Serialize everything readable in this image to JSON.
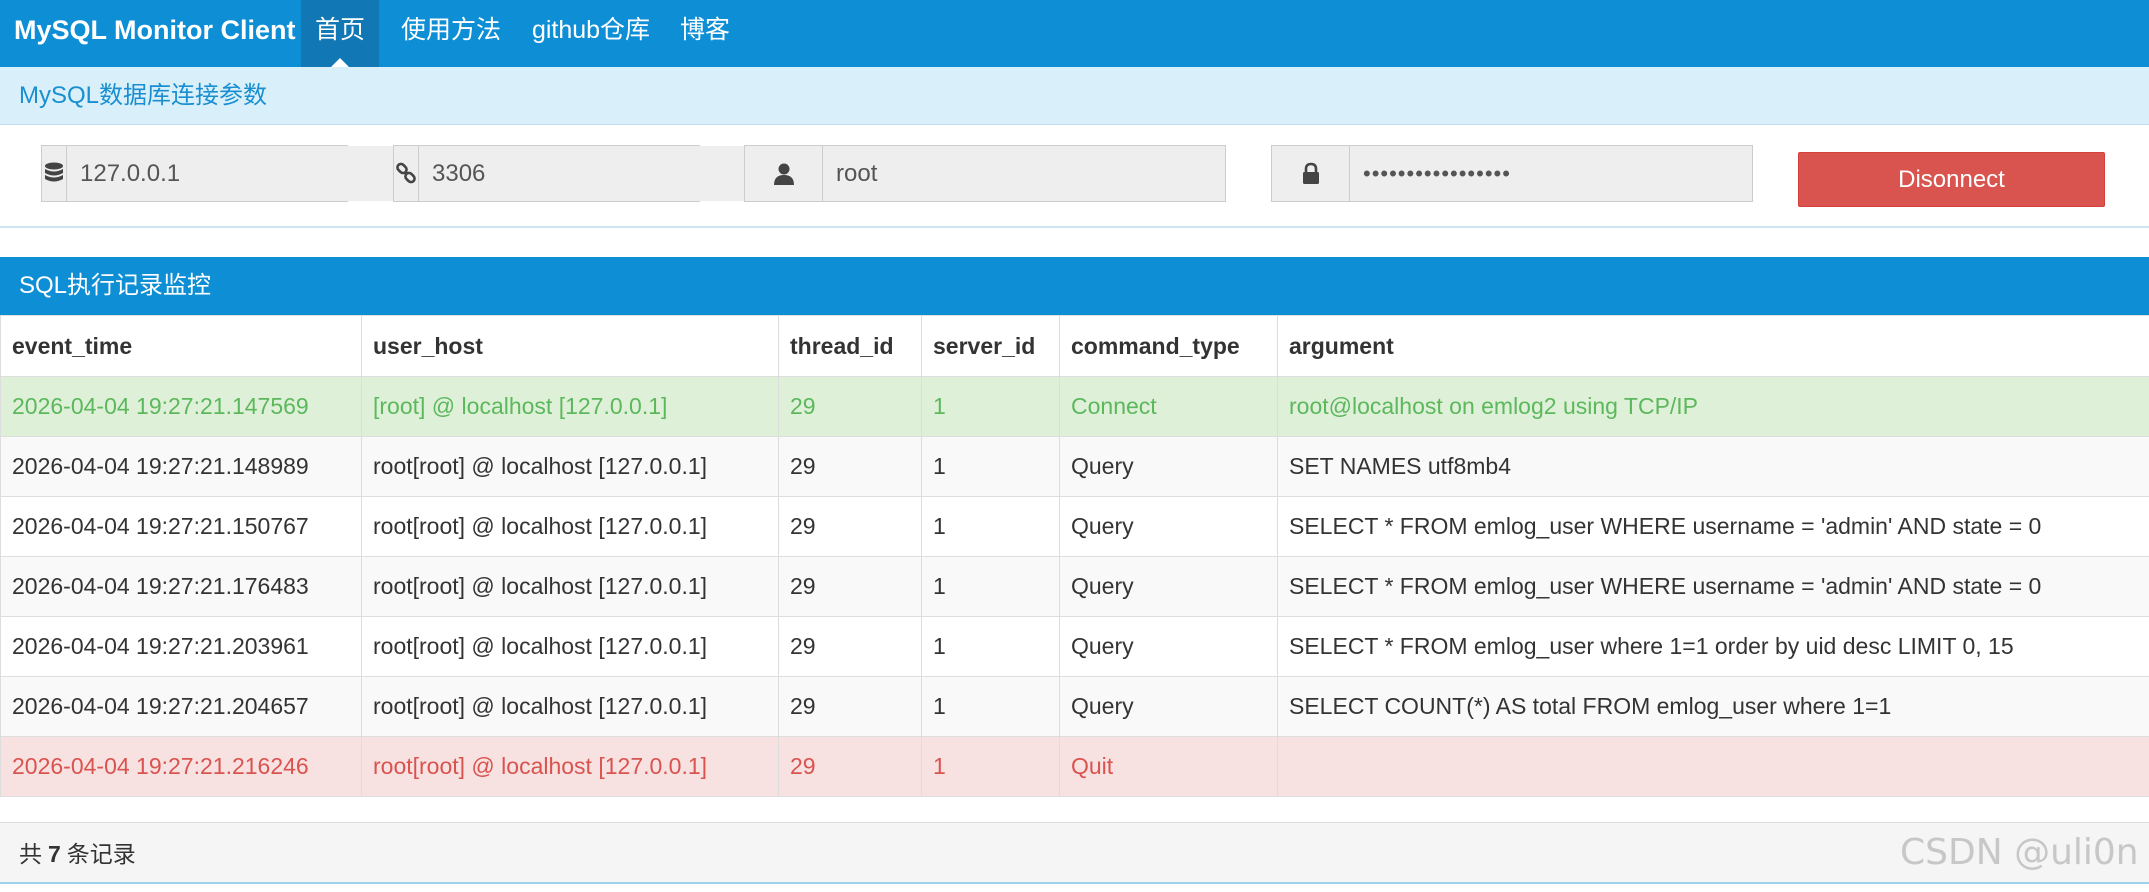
{
  "navbar": {
    "brand": "MySQL Monitor Client",
    "items": [
      {
        "label": "首页",
        "active": true
      },
      {
        "label": "使用方法",
        "active": false
      },
      {
        "label": "github仓库",
        "active": false
      },
      {
        "label": "博客",
        "active": false
      }
    ],
    "color": "#0e8ed4"
  },
  "connection": {
    "heading": "MySQL数据库连接参数",
    "host": {
      "value": "127.0.0.1",
      "icon": "database-icon"
    },
    "port": {
      "value": "3306",
      "icon": "link-icon"
    },
    "user": {
      "value": "root",
      "icon": "user-icon"
    },
    "password": {
      "value": "•••••••••••••••••",
      "icon": "lock-icon"
    },
    "disconnect_label": "Disonnect",
    "disconnect_color": "#d9534f"
  },
  "monitor": {
    "heading": "SQL执行记录监控",
    "columns": [
      "event_time",
      "user_host",
      "thread_id",
      "server_id",
      "command_type",
      "argument"
    ],
    "rows": [
      {
        "event_time": "2026-04-04 19:27:21.147569",
        "user_host": "[root] @ localhost [127.0.0.1]",
        "thread_id": "29",
        "server_id": "1",
        "command_type": "Connect",
        "argument": "root@localhost on emlog2 using TCP/IP",
        "status": "success"
      },
      {
        "event_time": "2026-04-04 19:27:21.148989",
        "user_host": "root[root] @ localhost [127.0.0.1]",
        "thread_id": "29",
        "server_id": "1",
        "command_type": "Query",
        "argument": "SET NAMES utf8mb4",
        "status": "normal"
      },
      {
        "event_time": "2026-04-04 19:27:21.150767",
        "user_host": "root[root] @ localhost [127.0.0.1]",
        "thread_id": "29",
        "server_id": "1",
        "command_type": "Query",
        "argument": "SELECT * FROM emlog_user WHERE username = 'admin' AND state = 0",
        "status": "normal"
      },
      {
        "event_time": "2026-04-04 19:27:21.176483",
        "user_host": "root[root] @ localhost [127.0.0.1]",
        "thread_id": "29",
        "server_id": "1",
        "command_type": "Query",
        "argument": "SELECT * FROM emlog_user WHERE username = 'admin' AND state = 0",
        "status": "normal"
      },
      {
        "event_time": "2026-04-04 19:27:21.203961",
        "user_host": "root[root] @ localhost [127.0.0.1]",
        "thread_id": "29",
        "server_id": "1",
        "command_type": "Query",
        "argument": "SELECT * FROM emlog_user where 1=1 order by uid desc LIMIT 0, 15",
        "status": "normal"
      },
      {
        "event_time": "2026-04-04 19:27:21.204657",
        "user_host": "root[root] @ localhost [127.0.0.1]",
        "thread_id": "29",
        "server_id": "1",
        "command_type": "Query",
        "argument": "SELECT COUNT(*) AS total FROM emlog_user where 1=1",
        "status": "normal"
      },
      {
        "event_time": "2026-04-04 19:27:21.216246",
        "user_host": "root[root] @ localhost [127.0.0.1]",
        "thread_id": "29",
        "server_id": "1",
        "command_type": "Quit",
        "argument": "",
        "status": "danger"
      }
    ],
    "footer": {
      "prefix": "共",
      "count": "7",
      "suffix": "条记录"
    }
  },
  "watermark": "CSDN @uli0n"
}
